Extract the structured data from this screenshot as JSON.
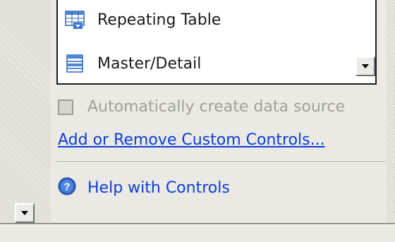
{
  "controls_list": {
    "items": [
      {
        "label": "Repeating Table",
        "icon": "repeating-table-icon"
      },
      {
        "label": "Master/Detail",
        "icon": "master-detail-icon"
      }
    ]
  },
  "options": {
    "auto_create_label": "Automatically create data source",
    "auto_create_checked": false,
    "auto_create_enabled": false
  },
  "links": {
    "custom_controls": "Add or Remove Custom Controls...",
    "help": "Help with Controls"
  },
  "colors": {
    "link": "#0b3ed8",
    "disabled_text": "#a09f99",
    "panel_bg": "#eae9e3"
  }
}
